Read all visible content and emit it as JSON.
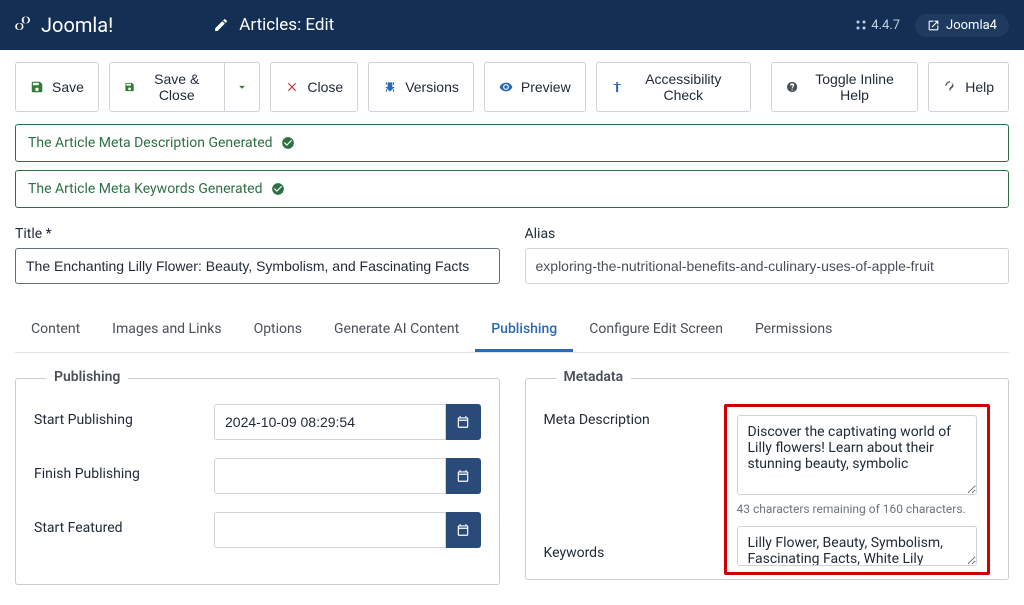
{
  "topbar": {
    "brand": "Joomla!",
    "page_title": "Articles: Edit",
    "version": "4.4.7",
    "site_name": "Joomla4"
  },
  "toolbar": {
    "save": "Save",
    "save_close": "Save & Close",
    "close": "Close",
    "versions": "Versions",
    "preview": "Preview",
    "accessibility": "Accessibility Check",
    "inline_help": "Toggle Inline Help",
    "help": "Help"
  },
  "alerts": {
    "meta_desc": "The Article Meta Description Generated",
    "meta_keywords": "The Article Meta Keywords Generated"
  },
  "form": {
    "title_label": "Title *",
    "title_value": "The Enchanting Lilly Flower: Beauty, Symbolism, and Fascinating Facts",
    "alias_label": "Alias",
    "alias_value": "exploring-the-nutritional-benefits-and-culinary-uses-of-apple-fruit"
  },
  "tabs": [
    {
      "label": "Content"
    },
    {
      "label": "Images and Links"
    },
    {
      "label": "Options"
    },
    {
      "label": "Generate AI Content"
    },
    {
      "label": "Publishing"
    },
    {
      "label": "Configure Edit Screen"
    },
    {
      "label": "Permissions"
    }
  ],
  "publishing": {
    "legend": "Publishing",
    "start_label": "Start Publishing",
    "start_value": "2024-10-09 08:29:54",
    "finish_label": "Finish Publishing",
    "finish_value": "",
    "featured_label": "Start Featured",
    "featured_value": ""
  },
  "metadata": {
    "legend": "Metadata",
    "desc_label": "Meta Description",
    "desc_value": "Discover the captivating world of Lilly flowers! Learn about their stunning beauty, symbolic",
    "desc_counter": "43 characters remaining of 160 characters.",
    "keywords_label": "Keywords",
    "keywords_value": "Lilly Flower, Beauty, Symbolism, Fascinating Facts, White Lily"
  }
}
